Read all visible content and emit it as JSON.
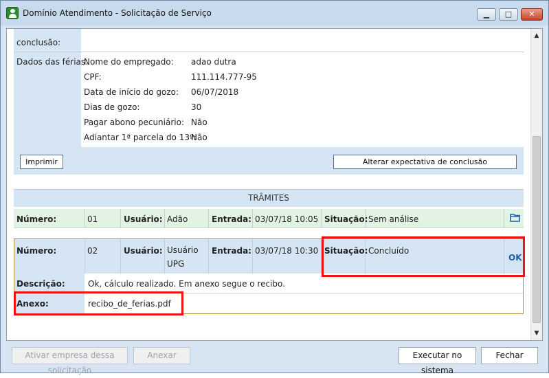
{
  "window": {
    "title": "Domínio Atendimento - Solicitação de Serviço"
  },
  "top": {
    "conclusao_label": "conclusão:"
  },
  "ferias": {
    "label": "Dados das férias:",
    "rows": [
      {
        "label": "Nome do empregado:",
        "value": "adao dutra"
      },
      {
        "label": "CPF:",
        "value": "111.114.777-95"
      },
      {
        "label": "Data de início do gozo:",
        "value": "06/07/2018"
      },
      {
        "label": "Dias de gozo:",
        "value": "30"
      },
      {
        "label": "Pagar abono pecuniário:",
        "value": "Não"
      },
      {
        "label": "Adiantar 1ª parcela do 13º:",
        "value": "Não"
      }
    ]
  },
  "actions": {
    "imprimir": "Imprimir",
    "alterar": "Alterar expectativa de conclusão"
  },
  "tramites": {
    "title": "TRÂMITES",
    "labels": {
      "numero": "Número:",
      "usuario": "Usuário:",
      "entrada": "Entrada:",
      "situacao": "Situação:",
      "descricao": "Descrição:",
      "anexo": "Anexo:"
    },
    "items": [
      {
        "numero": "01",
        "usuario": "Adão",
        "entrada": "03/07/18 10:05",
        "situacao": "Sem análise"
      },
      {
        "numero": "02",
        "usuario": "Usuário UPG",
        "entrada": "03/07/18 10:30",
        "situacao": "Concluído",
        "ok": "OK",
        "descricao": "Ok, cálculo realizado. Em anexo segue o recibo.",
        "anexo": "recibo_de_ferias.pdf"
      }
    ]
  },
  "footer": {
    "ativar": "Ativar empresa dessa solicitação",
    "anexar": "Anexar",
    "executar": "Executar no sistema",
    "fechar": "Fechar"
  },
  "colors": {
    "highlight": "#ee1111",
    "accent": "#1a5fa8"
  },
  "icons": [
    "app-icon",
    "minimize-icon",
    "maximize-icon",
    "close-icon",
    "folder-icon",
    "scroll-up-icon",
    "scroll-down-icon"
  ]
}
